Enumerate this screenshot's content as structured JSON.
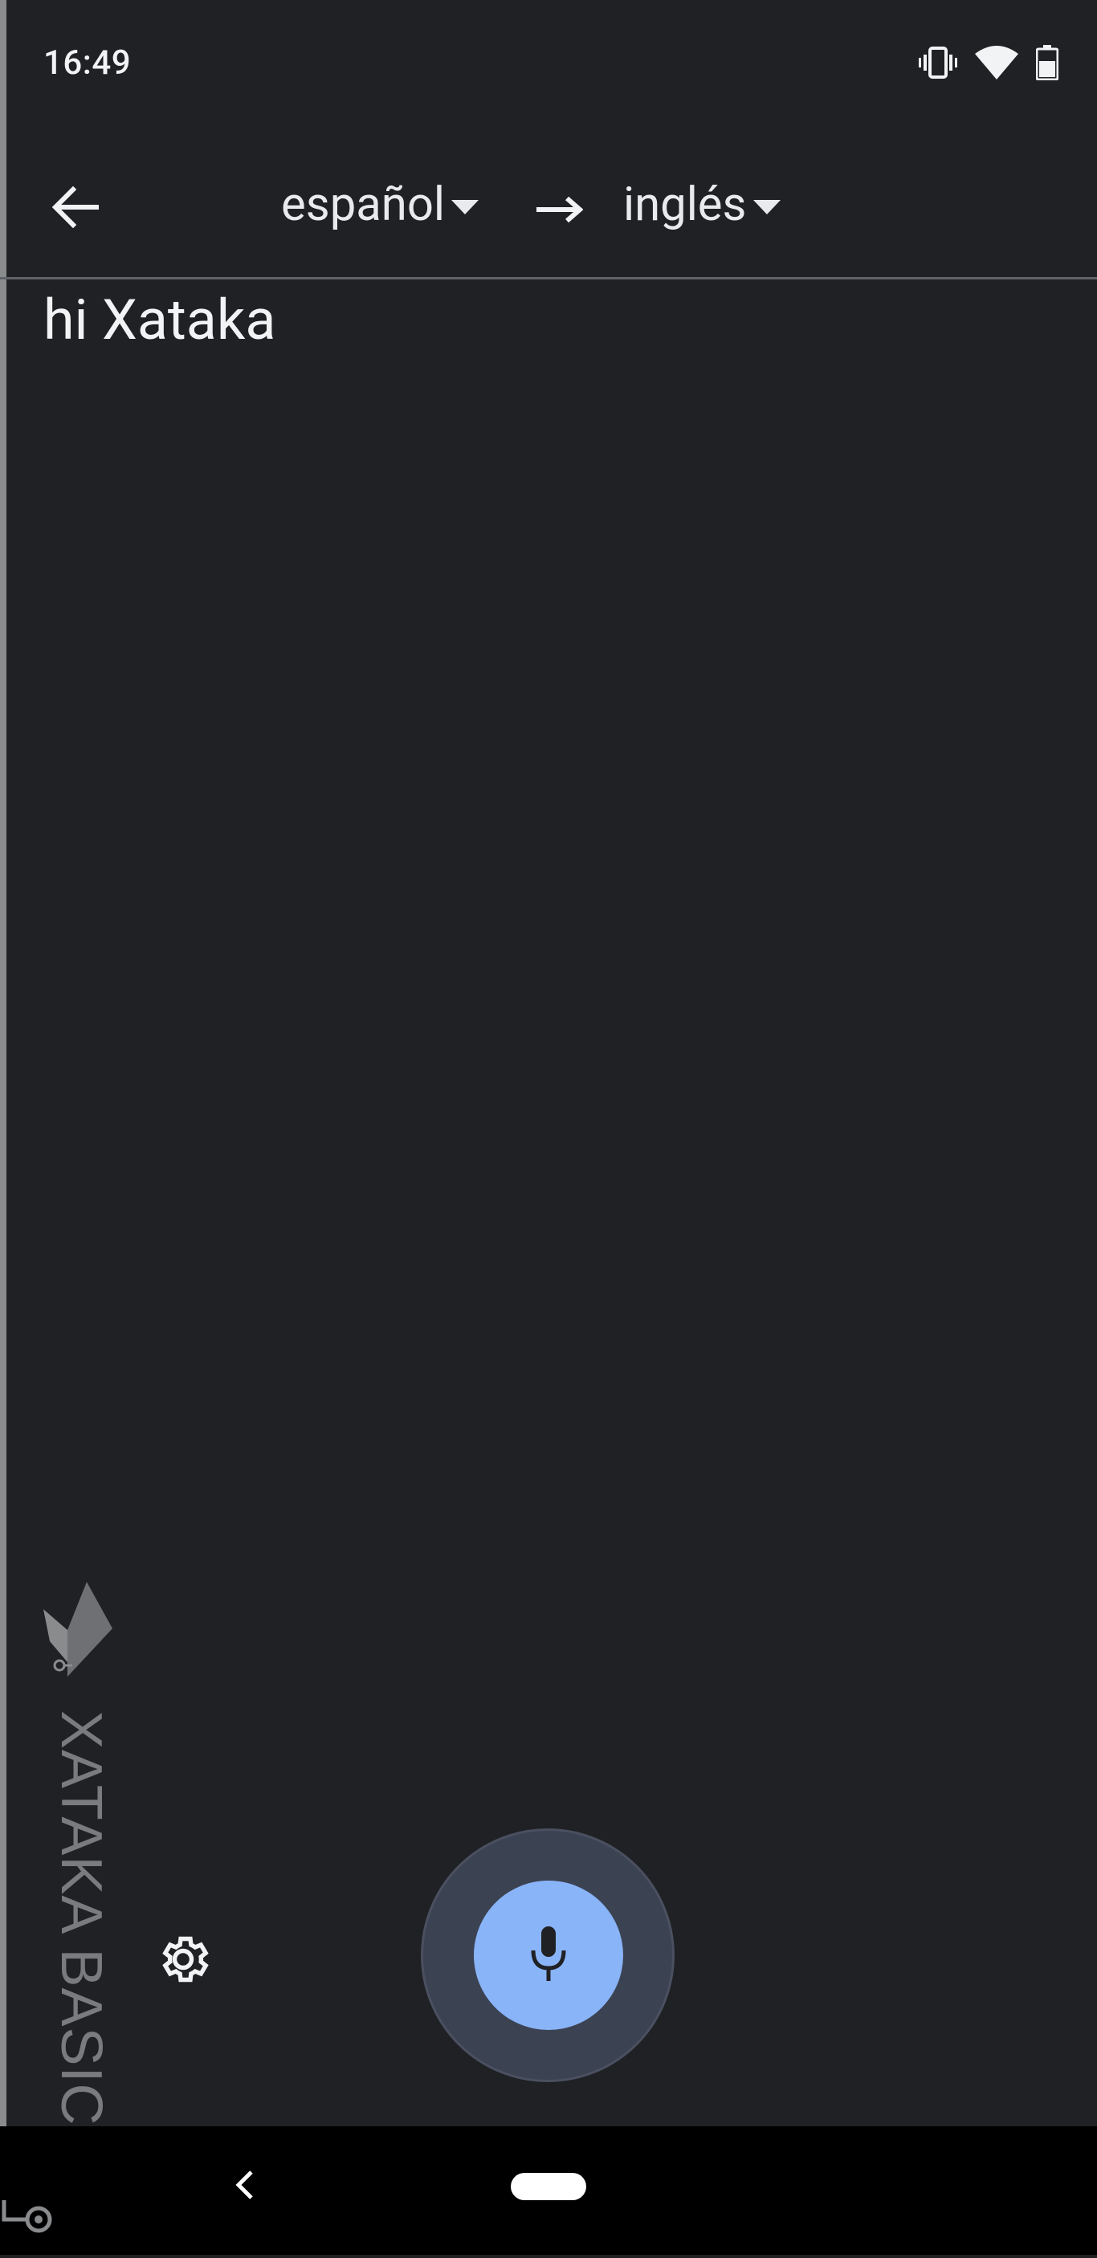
{
  "status_bar": {
    "time": "16:49",
    "icons": [
      "vibrate-icon",
      "wifi-icon",
      "battery-icon"
    ]
  },
  "toolbar": {
    "back_icon": "arrow-left-icon",
    "source_language": "español",
    "target_language": "inglés",
    "direction_icon": "arrow-right-icon"
  },
  "transcription": {
    "text": "hi Xataka"
  },
  "watermark": {
    "text": "XATAKA BASICS"
  },
  "controls": {
    "settings_icon": "gear-icon",
    "mic_icon": "microphone-icon"
  },
  "navigation": {
    "back_icon": "chevron-left-icon",
    "home_icon": "home-pill"
  },
  "colors": {
    "background": "#202124",
    "accent": "#8ab4f8",
    "text": "#e8eaed",
    "mic_halo": "#3b4252",
    "nav_bar": "#000000"
  }
}
